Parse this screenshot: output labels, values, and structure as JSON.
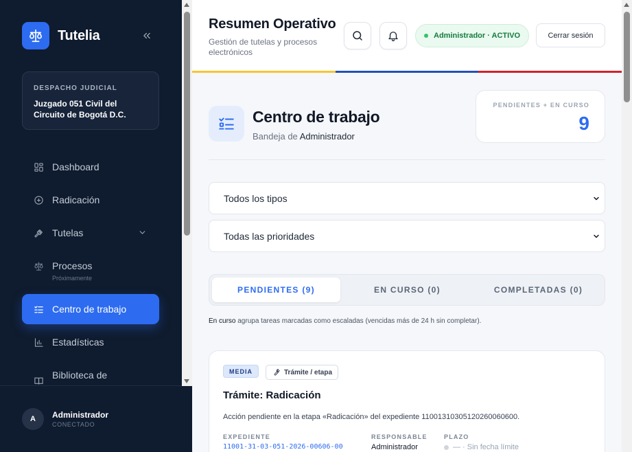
{
  "app": {
    "name": "Tutelia"
  },
  "colors": {
    "primary": "#2d6cf0",
    "sidebar": "#0f1b2e",
    "flag_yellow": "#f7c531",
    "flag_blue": "#2350b5",
    "flag_red": "#d3202d"
  },
  "sidebar": {
    "court_kicker": "DESPACHO JUDICIAL",
    "court_name": "Juzgado 051 Civil del Circuito de Bogotá D.C.",
    "items": [
      {
        "label": "Dashboard",
        "icon": "dashboard-icon"
      },
      {
        "label": "Radicación",
        "icon": "plus-circle-icon"
      },
      {
        "label": "Tutelas",
        "icon": "gavel-icon"
      },
      {
        "label": "Procesos",
        "icon": "scale-icon",
        "sub": "Próximamente"
      },
      {
        "label": "Centro de trabajo",
        "icon": "checklist-icon",
        "active": true
      },
      {
        "label": "Estadísticas",
        "icon": "bar-chart-icon"
      },
      {
        "label": "Biblioteca de",
        "icon": "book-icon"
      }
    ],
    "user": {
      "initial": "A",
      "name": "Administrador",
      "status": "CONECTADO"
    }
  },
  "header": {
    "title": "Resumen Operativo",
    "subtitle": "Gestión de tutelas y procesos electrónicos",
    "role_badge": "Administrador · ACTIVO",
    "logout_label": "Cerrar sesión"
  },
  "work_center": {
    "title": "Centro de trabajo",
    "subtitle_prefix": "Bandeja de",
    "subtitle_user": "Administrador",
    "count_label": "PENDIENTES + EN CURSO",
    "count_value": "9"
  },
  "filters": {
    "type": {
      "selected": "Todos los tipos"
    },
    "priority": {
      "selected": "Todas las prioridades"
    }
  },
  "tabs": [
    {
      "label": "PENDIENTES (9)",
      "active": true
    },
    {
      "label": "EN CURSO (0)",
      "active": false
    },
    {
      "label": "COMPLETADAS (0)",
      "active": false
    }
  ],
  "hint": {
    "strong": "En curso",
    "rest": "agrupa tareas marcadas como escaladas (vencidas más de 24 h sin completar)."
  },
  "task": {
    "priority": "MEDIA",
    "type": "Trámite / etapa",
    "title": "Trámite: Radicación",
    "description": "Acción pendiente en la etapa «Radicación» del expediente 11001310305120260060600.",
    "labels": {
      "expediente": "EXPEDIENTE",
      "responsable": "RESPONSABLE",
      "plazo": "PLAZO"
    },
    "expediente": "11001-31-03-051-2026-00606-00",
    "responsable": "Administrador",
    "plazo": "— · Sin fecha límite"
  }
}
